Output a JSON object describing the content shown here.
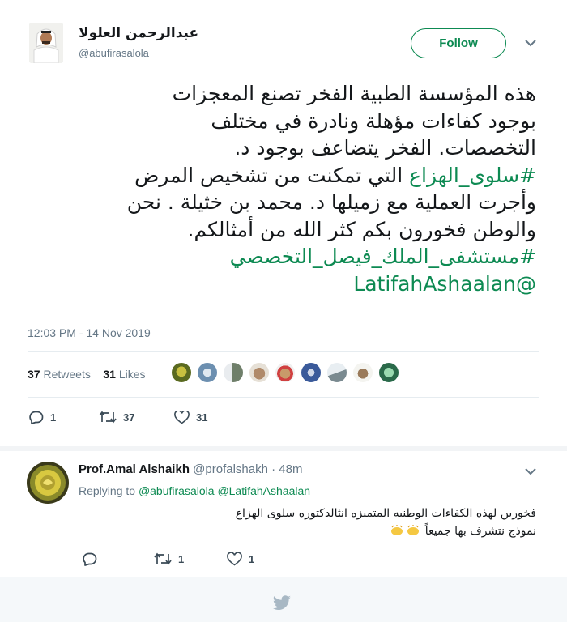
{
  "tweet": {
    "author_name": "عبدالرحمن العلولا",
    "author_handle": "@abufirasalola",
    "follow_label": "Follow",
    "text_lines": [
      "هذه المؤسسة الطبية الفخر تصنع المعجزات",
      "بوجود كفاءات مؤهلة ونادرة في مختلف",
      "التخصصات. الفخر يتضاعف بوجود د."
    ],
    "hashtag_1": "#سلوى_الهزاع",
    "text_after_hashtag_1": " التي تمكنت من تشخيص المرض",
    "text_lines_2": [
      "وأجرت العملية مع زميلها د. محمد بن خثيلة . نحن",
      "والوطن فخورون بكم كثر الله من أمثالكم."
    ],
    "hashtag_2": "#مستشفى_الملك_فيصل_التخصصي",
    "mention": "@LatifahAshaalan",
    "timestamp": "12:03 PM - 14 Nov 2019",
    "retweets_count": "37",
    "retweets_label": "Retweets",
    "likes_count": "31",
    "likes_label": "Likes",
    "reply_count": "1",
    "retweet_action_count": "37",
    "like_action_count": "31",
    "liker_avatar_colors": [
      "#a8a23a",
      "#6c8fb0",
      "#8a9a8a",
      "#b08a6a",
      "#c89a6a",
      "#3a5a9a",
      "#b0b8c0",
      "#9a7a5a",
      "#4a8a6a"
    ]
  },
  "reply": {
    "author_name": "Prof.Amal Alshaikh",
    "author_handle": "@profalshakh",
    "time": "48m",
    "replying_prefix": "Replying to",
    "replying_to_1": "@abufirasalola",
    "replying_to_2": "@LatifahAshaalan",
    "text_line_1": "فخورين لهذه الكفاءات الوطنيه المتميزه انثالدكتوره سلوى الهزاع",
    "text_line_2": "نموذج نتشرف بها جميعاً",
    "reply_count": "",
    "retweet_count": "1",
    "like_count": "1"
  },
  "colors": {
    "accent": "#0d8a52",
    "muted": "#657786",
    "text": "#14171a"
  }
}
